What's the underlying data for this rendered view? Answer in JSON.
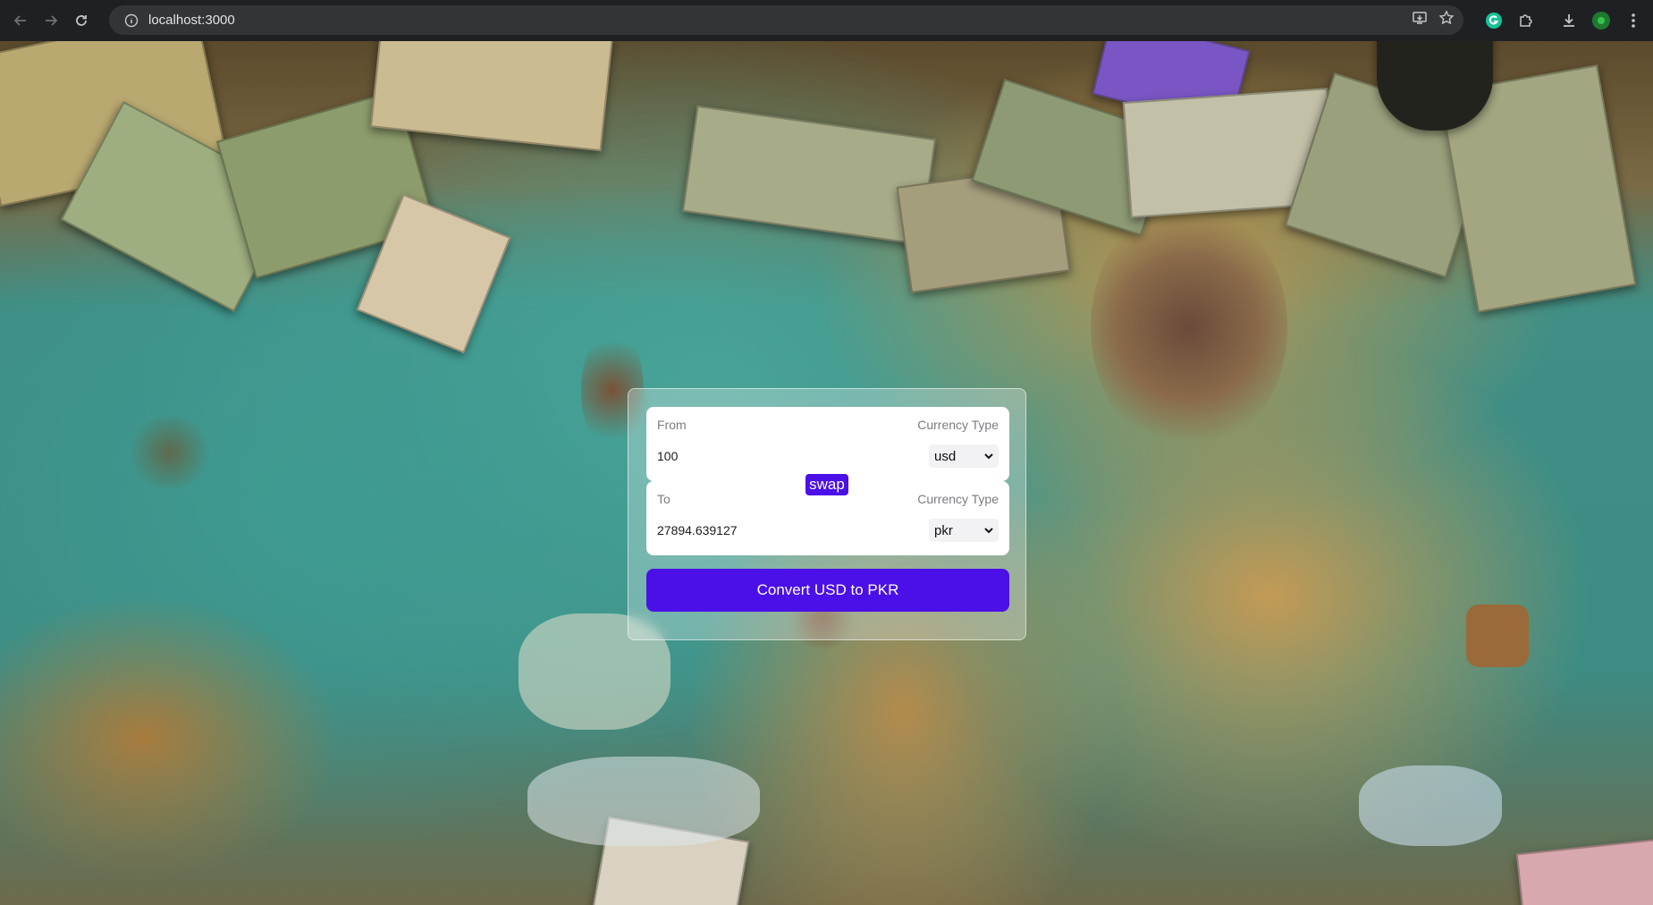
{
  "browser": {
    "url": "localhost:3000",
    "icons": [
      "back-icon",
      "forward-icon",
      "reload-icon",
      "site-info-icon",
      "install-icon",
      "bookmark-star-icon",
      "grammarly-icon",
      "extensions-icon",
      "download-icon",
      "profile-avatar-icon",
      "menu-icon"
    ]
  },
  "converter": {
    "from_label": "From",
    "from_currency_label": "Currency Type",
    "from_amount": "100",
    "from_currency": "usd",
    "swap_label": "swap",
    "to_label": "To",
    "to_currency_label": "Currency Type",
    "to_amount": "27894.639127",
    "to_currency": "pkr",
    "convert_label": "Convert USD to PKR"
  },
  "colors": {
    "accent": "#4b0fe8",
    "chrome_bg": "#1f2023",
    "omnibox_bg": "#323438"
  }
}
